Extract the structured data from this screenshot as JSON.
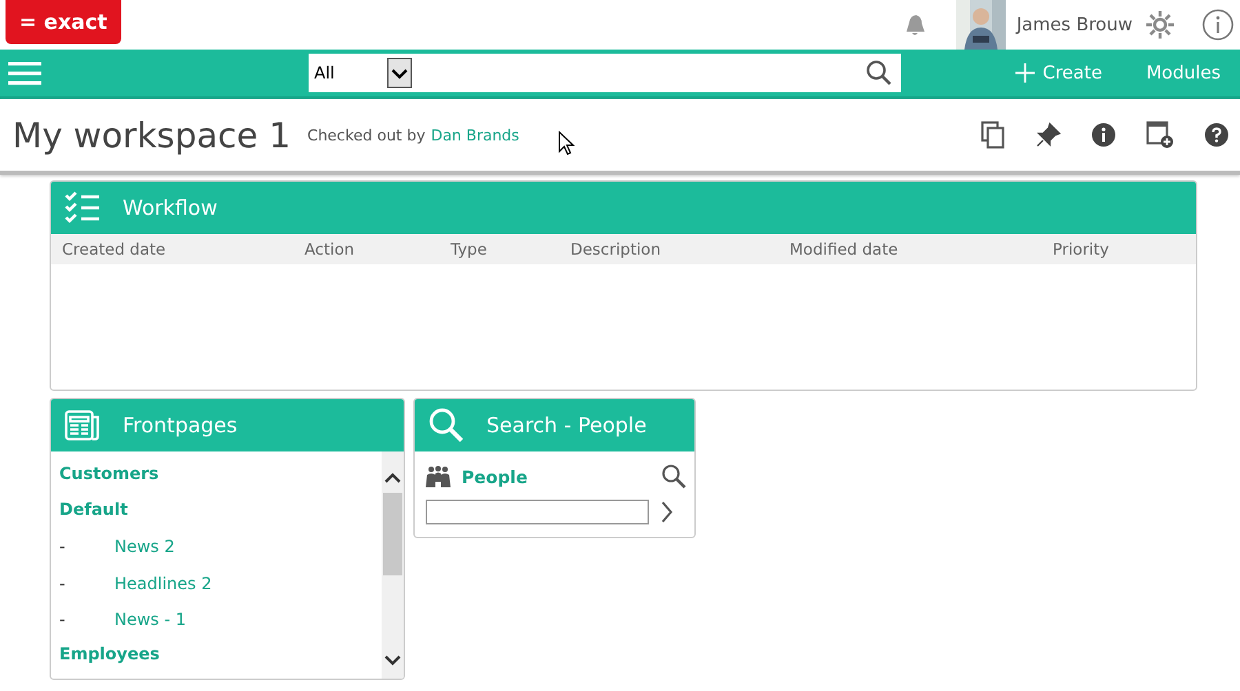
{
  "header": {
    "logo": "= exact",
    "user_name": "James Brouw"
  },
  "navbar": {
    "search": {
      "scope": "All"
    },
    "create": "Create",
    "modules": "Modules"
  },
  "page": {
    "title": "My workspace 1",
    "checkout_text": "Checked out by",
    "checkout_user": "Dan Brands"
  },
  "workflow": {
    "title": "Workflow",
    "columns": [
      "Created date",
      "Action",
      "Type",
      "Description",
      "Modified date",
      "Priority"
    ]
  },
  "frontpages": {
    "title": "Frontpages",
    "items": [
      {
        "kind": "group",
        "label": "Customers"
      },
      {
        "kind": "group",
        "label": "Default"
      },
      {
        "kind": "page",
        "bullet": "-",
        "label": "News 2"
      },
      {
        "kind": "page",
        "bullet": "-",
        "label": "Headlines 2"
      },
      {
        "kind": "page",
        "bullet": "-",
        "label": "News - 1"
      },
      {
        "kind": "group",
        "label": "Employees"
      }
    ]
  },
  "search_people": {
    "title": "Search - People",
    "label": "People"
  }
}
